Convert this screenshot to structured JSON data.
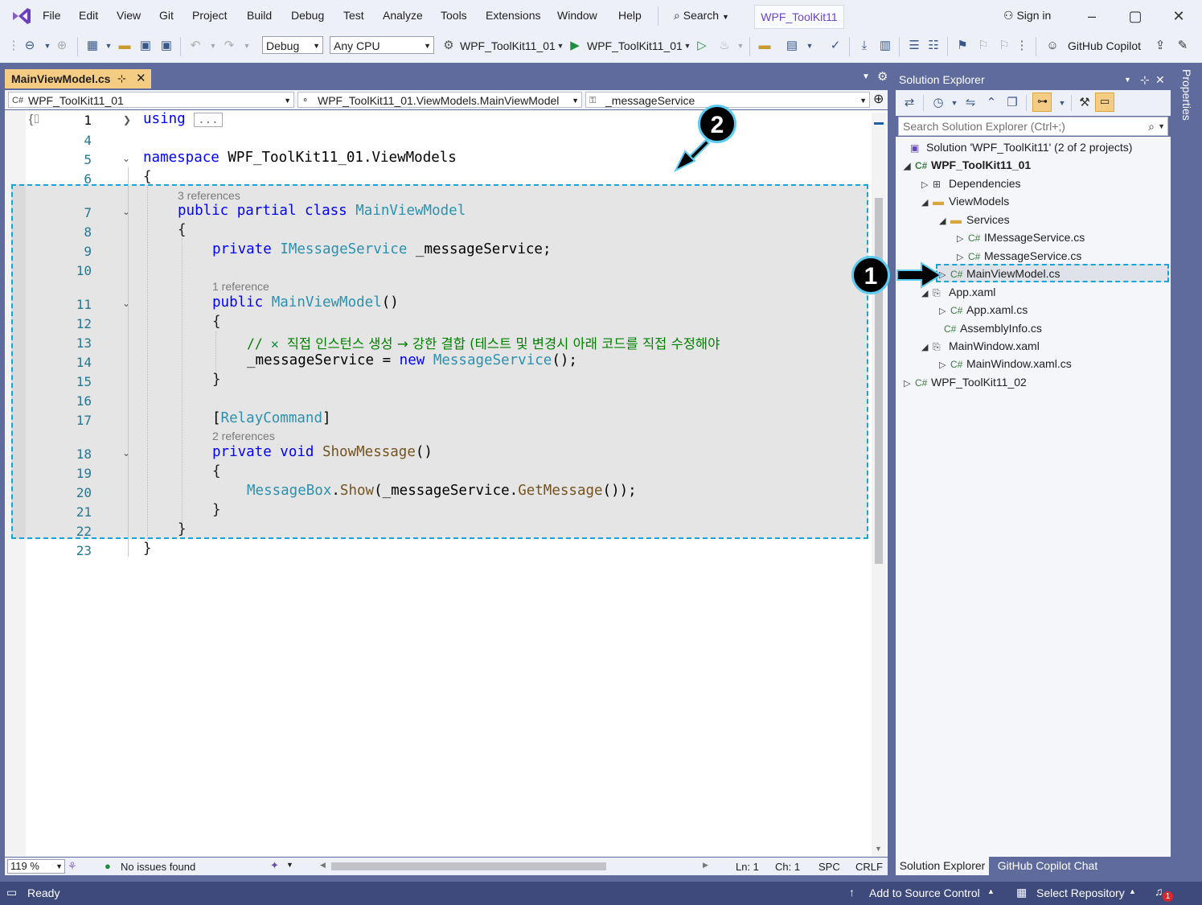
{
  "menu": {
    "items": [
      "File",
      "Edit",
      "View",
      "Git",
      "Project",
      "Build",
      "Debug",
      "Test",
      "Analyze",
      "Tools",
      "Extensions",
      "Window",
      "Help"
    ],
    "search_label": "Search",
    "solution_tab": "WPF_ToolKit11",
    "sign_in": "Sign in"
  },
  "toolbar": {
    "config": "Debug",
    "platform": "Any CPU",
    "startup_project": "WPF_ToolKit11_01",
    "run_target": "WPF_ToolKit11_01",
    "copilot": "GitHub Copilot"
  },
  "document": {
    "tab_title": "MainViewModel.cs",
    "nav_project": "WPF_ToolKit11_01",
    "nav_type": "WPF_ToolKit11_01.ViewModels.MainViewModel",
    "nav_member": "_messageService"
  },
  "code": {
    "line_numbers": [
      "1",
      "4",
      "5",
      "6",
      "7",
      "8",
      "9",
      "10",
      "11",
      "12",
      "13",
      "14",
      "15",
      "16",
      "17",
      "18",
      "19",
      "20",
      "21",
      "22",
      "23"
    ],
    "using_kw": "using",
    "using_collapsed": "...",
    "namespace_kw": "namespace",
    "namespace_name": "WPF_ToolKit11_01.ViewModels",
    "brace_open": "{",
    "brace_close": "}",
    "lens_class": "3 references",
    "class_decl_kw": "public partial class",
    "class_name": "MainViewModel",
    "field_kw": "private",
    "field_type": "IMessageService",
    "field_name": "_messageService;",
    "lens_ctor": "1 reference",
    "ctor_kw": "public",
    "ctor_name": "MainViewModel",
    "ctor_parens": "()",
    "comment_prefix": "//",
    "comment_text": "직접 인스턴스 생성 → 강한 결합 (테스트 및 변경시 아래 코드를 직접 수정해야",
    "assign_lhs": "_messageService = ",
    "new_kw": "new",
    "service_type": "MessageService",
    "call_end": "();",
    "attr_open": "[",
    "attr_name": "RelayCommand",
    "attr_close": "]",
    "lens_method": "2 references",
    "method_kw": "private void",
    "method_name": "ShowMessage",
    "method_parens": "()",
    "msgbox_type": "MessageBox",
    "msgbox_dot": ".",
    "msgbox_method": "Show",
    "msgbox_arg_open": "(_messageService.",
    "msgbox_getmsg": "GetMessage",
    "msgbox_end": "());"
  },
  "editor_status": {
    "zoom": "119 %",
    "issues": "No issues found",
    "ln": "Ln: 1",
    "ch": "Ch: 1",
    "spc": "SPC",
    "crlf": "CRLF"
  },
  "solution_explorer": {
    "title": "Solution Explorer",
    "search_placeholder": "Search Solution Explorer (Ctrl+;)",
    "nodes": {
      "solution": "Solution 'WPF_ToolKit11' (2 of 2 projects)",
      "project1": "WPF_ToolKit11_01",
      "dependencies": "Dependencies",
      "viewmodels": "ViewModels",
      "services": "Services",
      "imessageservice": "IMessageService.cs",
      "messageservice": "MessageService.cs",
      "mainviewmodel": "MainViewModel.cs",
      "appxaml": "App.xaml",
      "appxamlcs": "App.xaml.cs",
      "assemblyinfo": "AssemblyInfo.cs",
      "mainwindow": "MainWindow.xaml",
      "mainwindowcs": "MainWindow.xaml.cs",
      "project2": "WPF_ToolKit11_02"
    },
    "tabs": [
      "Solution Explorer",
      "GitHub Copilot Chat"
    ],
    "cs_glyph": "C#"
  },
  "properties_label": "Properties",
  "statusbar": {
    "ready": "Ready",
    "source_control": "Add to Source Control",
    "repo": "Select Repository",
    "notif_count": "1"
  },
  "callouts": [
    "1",
    "2"
  ],
  "colors": {
    "accent": "#5f6b9c",
    "tab_active": "#f5cc84",
    "highlight_border": "#17a4d6",
    "statusbar": "#3f4a7c"
  }
}
